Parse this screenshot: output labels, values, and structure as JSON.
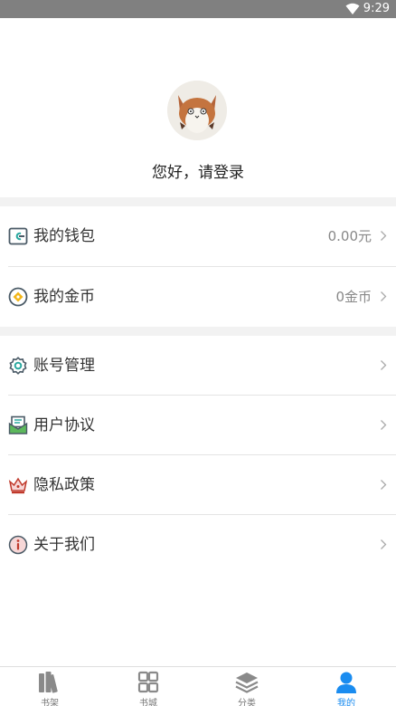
{
  "status_bar": {
    "time": "9:29"
  },
  "profile": {
    "greeting": "您好，请登录"
  },
  "menu": {
    "wallet": {
      "label": "我的钱包",
      "value": "0.00元"
    },
    "coins": {
      "label": "我的金币",
      "value": "0金币"
    },
    "account": {
      "label": "账号管理"
    },
    "agreement": {
      "label": "用户协议"
    },
    "privacy": {
      "label": "隐私政策"
    },
    "about": {
      "label": "关于我们"
    }
  },
  "tabs": [
    {
      "label": "书架",
      "icon": "bookshelf-icon",
      "active": false
    },
    {
      "label": "书城",
      "icon": "bookstore-icon",
      "active": false
    },
    {
      "label": "分类",
      "icon": "category-layers-icon",
      "active": false
    },
    {
      "label": "我的",
      "icon": "user-icon",
      "active": true
    }
  ],
  "colors": {
    "accent": "#1a8cf0",
    "status_bar": "#808080",
    "section_gap": "#f2f2f2"
  }
}
